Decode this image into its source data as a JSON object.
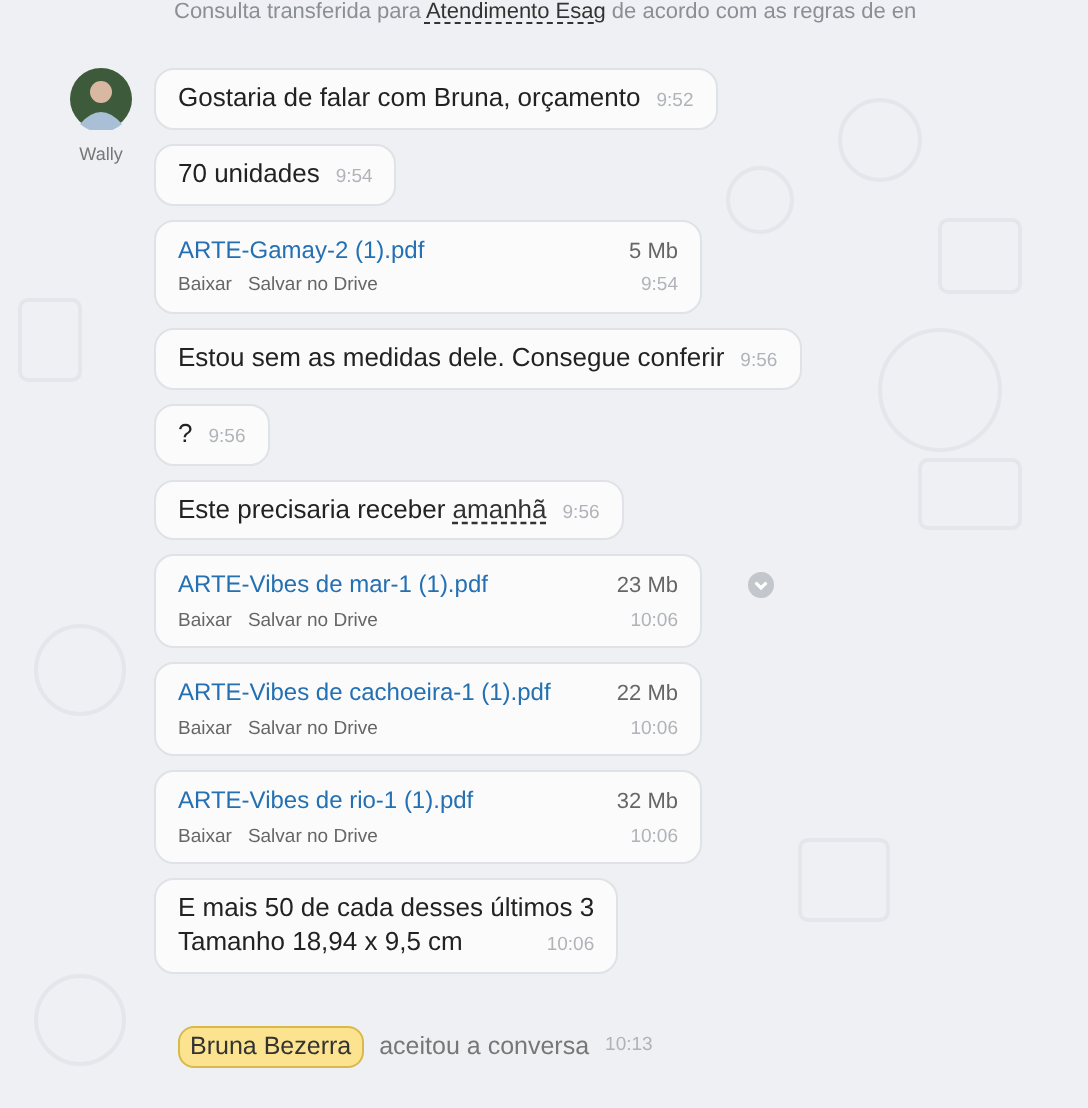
{
  "notice": {
    "parts": [
      {
        "text": "Consulta transferida para ",
        "underline": false
      },
      {
        "text": "Atendimento Esag",
        "underline": true
      },
      {
        "text": " de acordo com as regras de en",
        "underline": false
      }
    ]
  },
  "sender": {
    "name": "Wally"
  },
  "messages": [
    {
      "kind": "text",
      "parts": [
        {
          "text": "Gostaria de falar com Bruna, orçamento",
          "underline": false
        }
      ],
      "time": "9:52"
    },
    {
      "kind": "text",
      "parts": [
        {
          "text": "70 unidades",
          "underline": false
        }
      ],
      "time": "9:54"
    },
    {
      "kind": "file",
      "file_name": "ARTE-Gamay-2 (1).pdf",
      "size": "5 Mb",
      "actions": [
        "Baixar",
        "Salvar no Drive"
      ],
      "time": "9:54",
      "menu": false
    },
    {
      "kind": "text",
      "parts": [
        {
          "text": "Estou sem as medidas dele. Consegue conferir",
          "underline": false
        }
      ],
      "time": "9:56"
    },
    {
      "kind": "text",
      "parts": [
        {
          "text": "?",
          "underline": false
        }
      ],
      "time": "9:56"
    },
    {
      "kind": "text",
      "parts": [
        {
          "text": "Este precisaria receber ",
          "underline": false
        },
        {
          "text": "amanhã",
          "underline": true
        }
      ],
      "time": "9:56"
    },
    {
      "kind": "file",
      "file_name": "ARTE-Vibes de mar-1 (1).pdf",
      "size": "23 Mb",
      "actions": [
        "Baixar",
        "Salvar no Drive"
      ],
      "time": "10:06",
      "menu": true
    },
    {
      "kind": "file",
      "file_name": "ARTE-Vibes de cachoeira-1 (1).pdf",
      "size": "22 Mb",
      "actions": [
        "Baixar",
        "Salvar no Drive"
      ],
      "time": "10:06",
      "menu": false
    },
    {
      "kind": "file",
      "file_name": "ARTE-Vibes de rio-1 (1).pdf",
      "size": "32 Mb",
      "actions": [
        "Baixar",
        "Salvar no Drive"
      ],
      "time": "10:06",
      "menu": false
    },
    {
      "kind": "multiline",
      "lines": [
        "E mais 50 de cada desses últimos 3",
        "Tamanho 18,94 x 9,5 cm"
      ],
      "time": "10:06"
    }
  ],
  "event": {
    "agent": "Bruna Bezerra",
    "text": "aceitou a conversa",
    "time": "10:13"
  }
}
